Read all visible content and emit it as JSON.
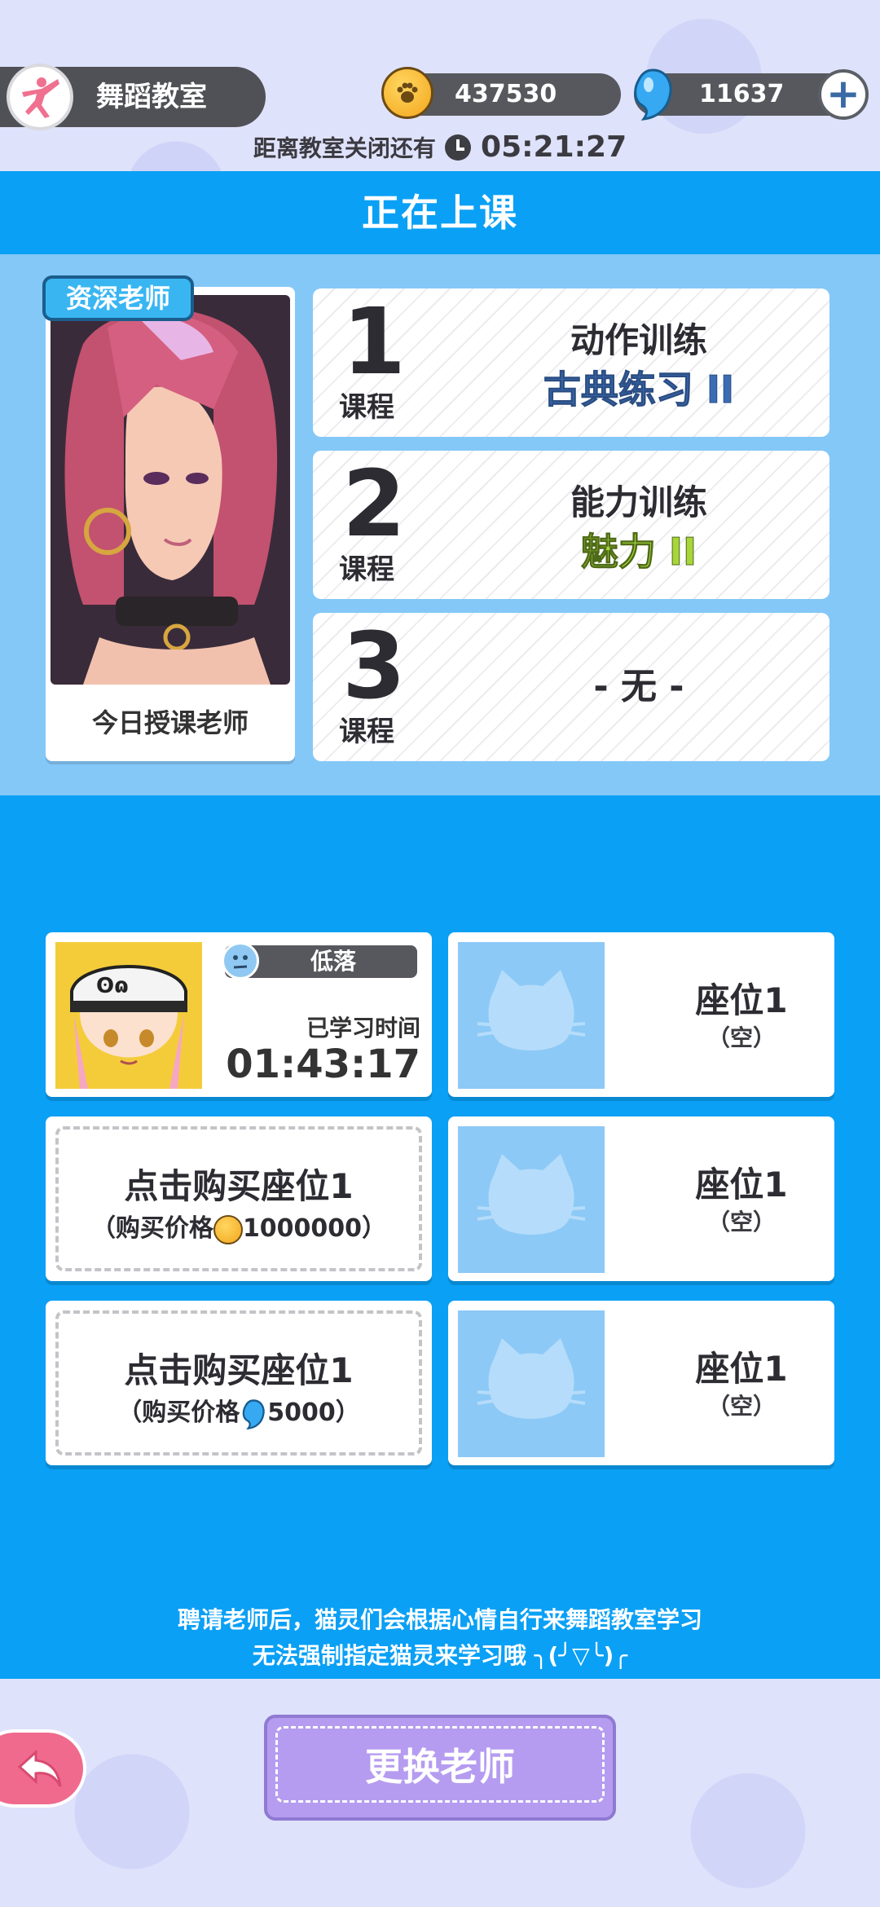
{
  "header": {
    "title": "舞蹈教室",
    "coins": "437530",
    "gems": "11637",
    "timer_label": "距离教室关闭还有",
    "timer_value": "05:21:27"
  },
  "banner": {
    "title": "正在上课"
  },
  "teacher": {
    "badge": "资深老师",
    "caption": "今日授课老师"
  },
  "courses": [
    {
      "number": "1",
      "tag": "课程",
      "name": "动作训练",
      "sub": "古典练习 II"
    },
    {
      "number": "2",
      "tag": "课程",
      "name": "能力训练",
      "sub": "魅力 II"
    },
    {
      "number": "3",
      "tag": "课程",
      "none": "- 无 -"
    }
  ],
  "occupied_seat": {
    "mood": "低落",
    "study_label": "已学习时间",
    "study_time": "01:43:17"
  },
  "buy_seats": [
    {
      "title": "点击购买座位1",
      "price_prefix": "（购买价格",
      "price": "1000000",
      "price_suffix": "）"
    },
    {
      "title": "点击购买座位1",
      "price_prefix": "（购买价格",
      "price": "5000",
      "price_suffix": "）"
    }
  ],
  "empty_seats": [
    {
      "title": "座位1",
      "sub": "（空）"
    },
    {
      "title": "座位1",
      "sub": "（空）"
    },
    {
      "title": "座位1",
      "sub": "（空）"
    }
  ],
  "notice": {
    "line1": "聘请老师后，猫灵们会根据心情自行来舞蹈教室学习",
    "line2": "无法强制指定猫灵来学习哦 ╮(╯▽╰)╭"
  },
  "buttons": {
    "change_teacher": "更换老师"
  },
  "colors": {
    "primary_blue": "#0aa0f5",
    "light_blue": "#84c8f8",
    "button_purple": "#b59cf0",
    "back_pink": "#f06a8e"
  }
}
